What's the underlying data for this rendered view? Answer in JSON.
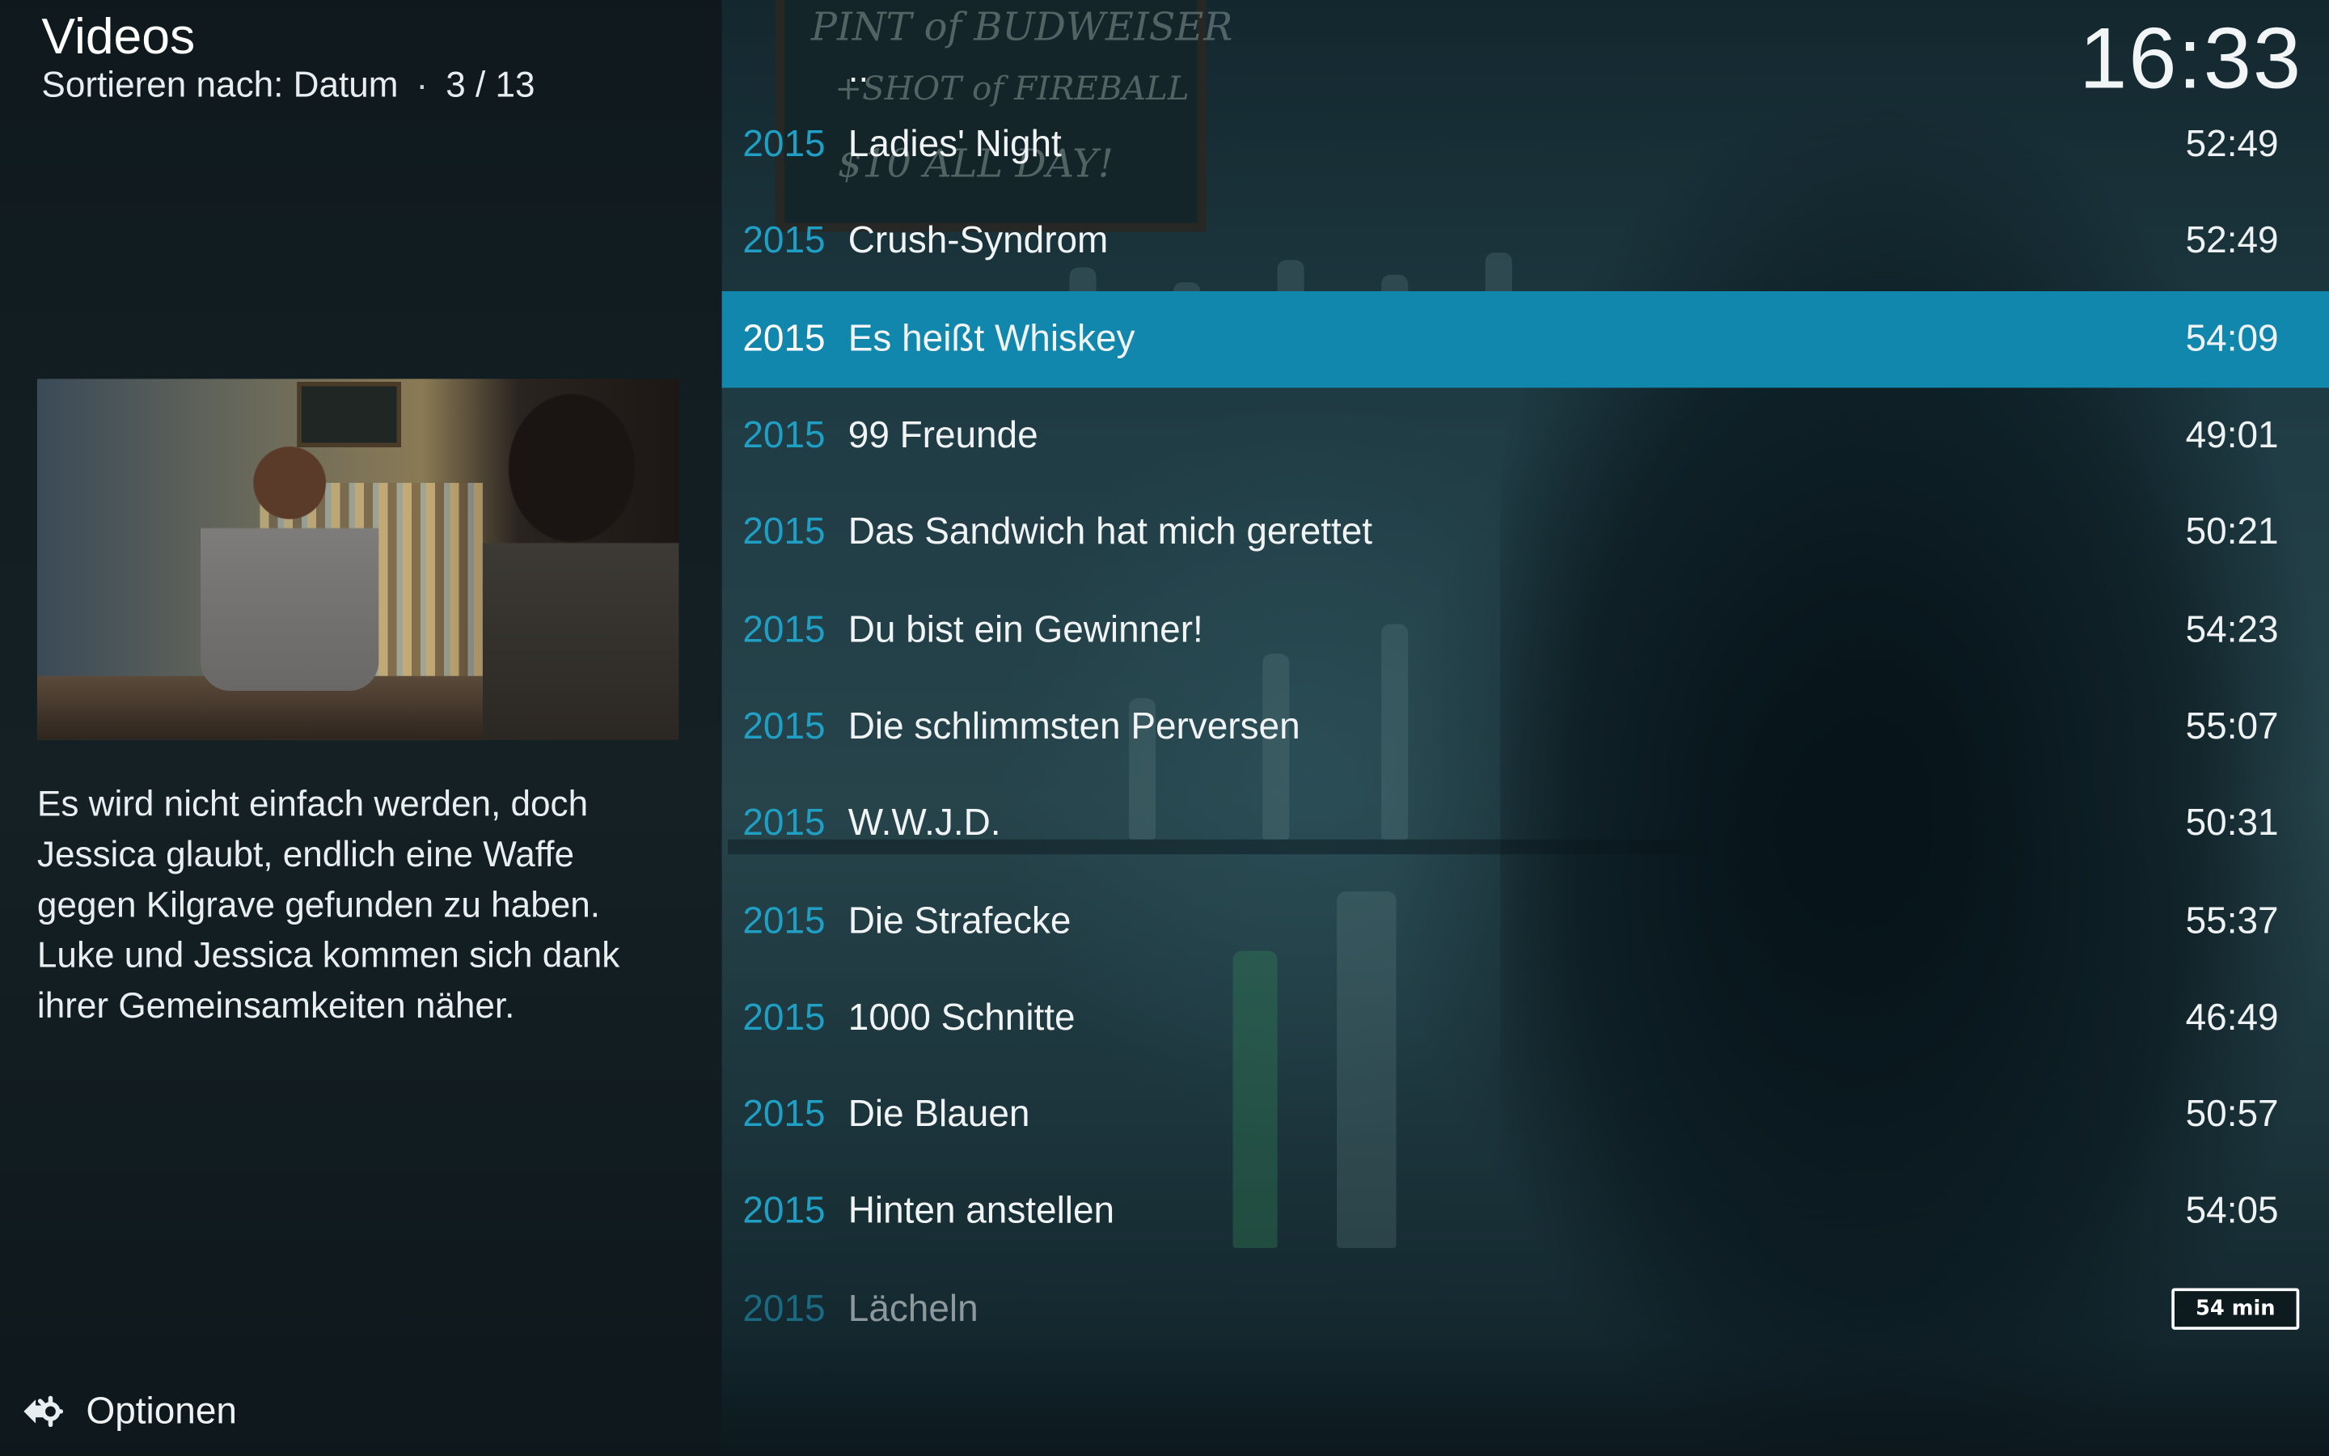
{
  "header": {
    "title": "Videos",
    "sort_label": "Sortieren nach: Datum",
    "separator": "·",
    "position": "3 / 13"
  },
  "clock": "16:33",
  "background_text": {
    "line1": "PINT of BUDWEISER",
    "line2": "+SHOT of FIREBALL",
    "line3": "$10 ALL DAY!"
  },
  "info_panel": {
    "plot": "Es wird nicht einfach werden, doch Jessica glaubt, endlich eine Waffe gegen Kilgrave gefunden zu haben. Luke und Jessica kommen sich dank ihrer Gemeinsamkeiten näher."
  },
  "options": {
    "label": "Optionen",
    "icon": "options-gear-icon"
  },
  "list": {
    "parent_label": "..",
    "selected_index": 2,
    "items": [
      {
        "year": "2015",
        "title": "Ladies' Night",
        "duration": "52:49"
      },
      {
        "year": "2015",
        "title": "Crush-Syndrom",
        "duration": "52:49"
      },
      {
        "year": "2015",
        "title": "Es heißt Whiskey",
        "duration": "54:09"
      },
      {
        "year": "2015",
        "title": "99 Freunde",
        "duration": "49:01"
      },
      {
        "year": "2015",
        "title": "Das Sandwich hat mich gerettet",
        "duration": "50:21"
      },
      {
        "year": "2015",
        "title": "Du bist ein Gewinner!",
        "duration": "54:23"
      },
      {
        "year": "2015",
        "title": "Die schlimmsten Perversen",
        "duration": "55:07"
      },
      {
        "year": "2015",
        "title": "W.W.J.D.",
        "duration": "50:31"
      },
      {
        "year": "2015",
        "title": "Die Strafecke",
        "duration": "55:37"
      },
      {
        "year": "2015",
        "title": "1000 Schnitte",
        "duration": "46:49"
      },
      {
        "year": "2015",
        "title": "Die Blauen",
        "duration": "50:57"
      },
      {
        "year": "2015",
        "title": "Hinten anstellen",
        "duration": "54:05"
      },
      {
        "year": "2015",
        "title": "Lächeln",
        "duration": "",
        "badge": "54 min"
      }
    ]
  },
  "colors": {
    "accent": "#1287ad",
    "year_text": "#1f9fc4",
    "panel_bg": "#0e161a"
  }
}
